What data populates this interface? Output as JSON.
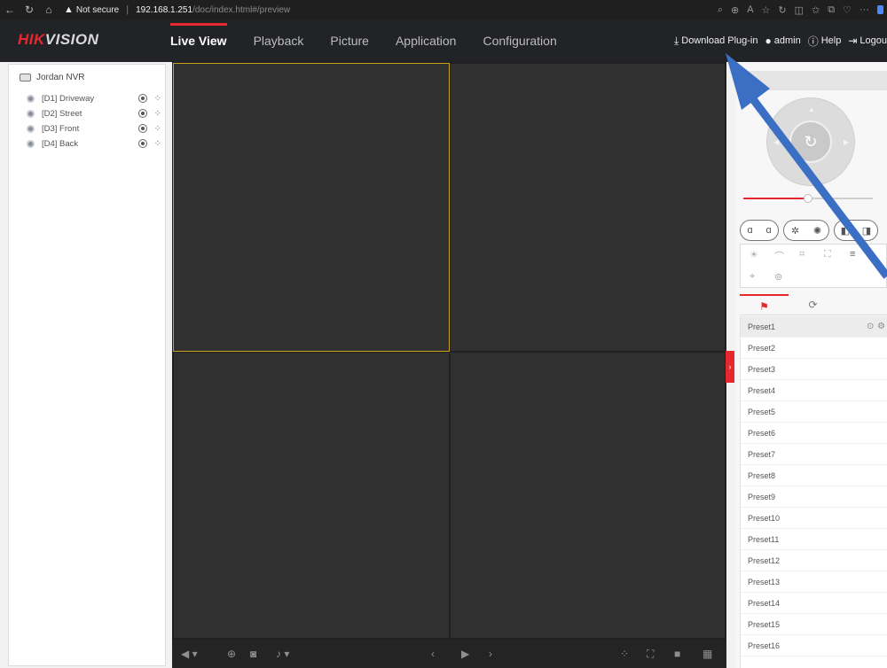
{
  "browser": {
    "back_icon": "back-arrow-icon",
    "warning_text": "Not secure",
    "url_host": "192.168.1.251",
    "url_path": "/doc/index.html#/preview",
    "more_label": "···"
  },
  "header": {
    "logo_part1": "HIK",
    "logo_part2": "VISION",
    "tabs": [
      "Live View",
      "Playback",
      "Picture",
      "Application",
      "Configuration"
    ],
    "download_label": "Download Plug-in",
    "user_label": "admin",
    "help_label": "Help",
    "logout_label": "Logou"
  },
  "devices": {
    "root": "Jordan NVR",
    "cameras": [
      "[D1] Driveway",
      "[D2] Street",
      "[D3] Front",
      "[D4] Back"
    ]
  },
  "presets": {
    "items": [
      "Preset1",
      "Preset2",
      "Preset3",
      "Preset4",
      "Preset5",
      "Preset6",
      "Preset7",
      "Preset8",
      "Preset9",
      "Preset10",
      "Preset11",
      "Preset12",
      "Preset13",
      "Preset14",
      "Preset15",
      "Preset16"
    ]
  },
  "colors": {
    "brand_red": "#e4282e",
    "annotation_blue": "#3b6fc4",
    "selected_cell": "#c7a21b"
  }
}
